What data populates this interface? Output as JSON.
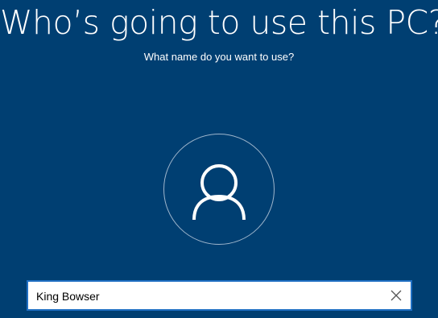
{
  "header": {
    "title": "Who’s going to use this PC?",
    "subtitle": "What name do you want to use?"
  },
  "avatar": {
    "icon": "user-icon"
  },
  "name_field": {
    "value": "King Bowser",
    "clear_icon": "close-icon"
  },
  "colors": {
    "background": "#003f72",
    "input_border": "#1f6fc3"
  }
}
